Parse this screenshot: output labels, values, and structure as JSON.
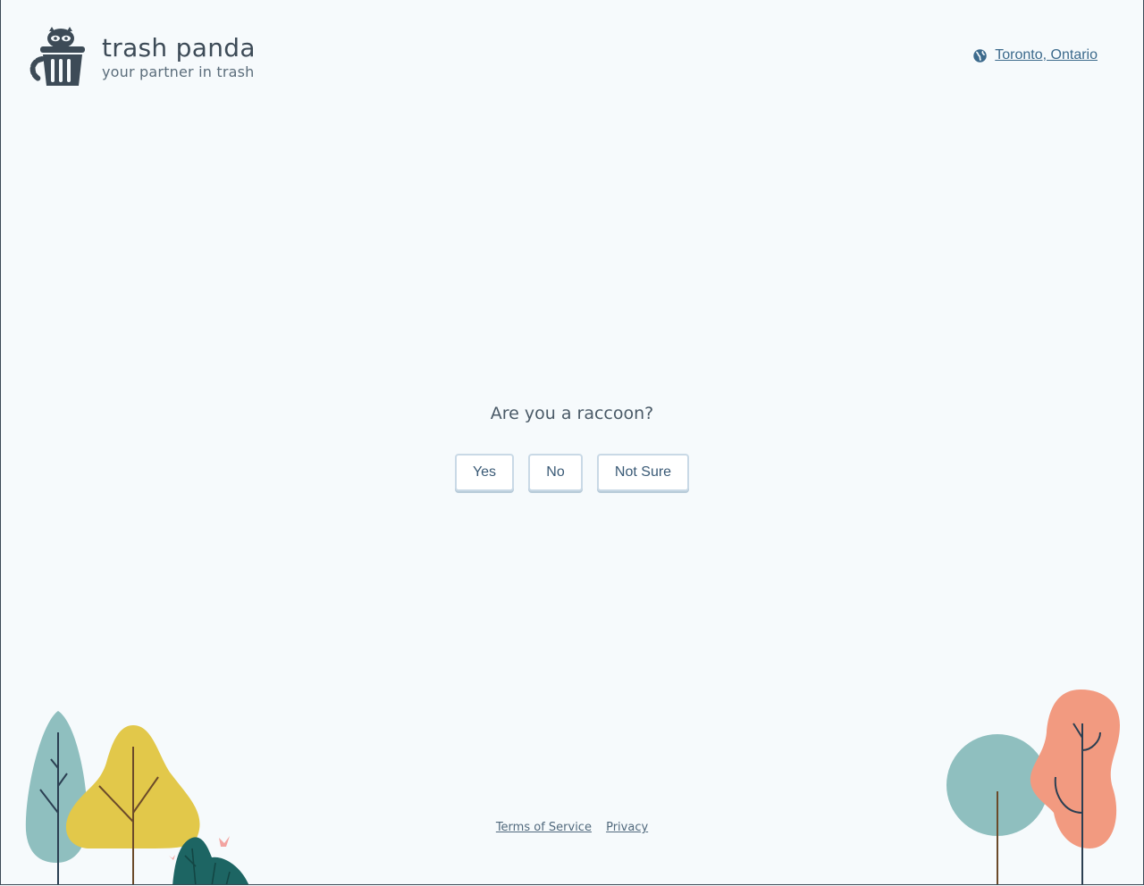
{
  "brand": {
    "name": "trash panda",
    "tagline": "your partner in trash",
    "logo_icon": "raccoon-trash-can-icon"
  },
  "location": {
    "label": "Toronto, Ontario",
    "icon": "globe-icon"
  },
  "prompt": {
    "question": "Are you a raccoon?",
    "options": [
      "Yes",
      "No",
      "Not Sure"
    ]
  },
  "footer": {
    "links": [
      "Terms of Service",
      "Privacy"
    ]
  },
  "colors": {
    "background": "#f6fafc",
    "text": "#3d4f5f",
    "link": "#3c6a8c",
    "tree_teal": "#8fbfbf",
    "tree_yellow": "#e2c84a",
    "tree_dark": "#1d6563",
    "tree_salmon": "#f29a80"
  }
}
